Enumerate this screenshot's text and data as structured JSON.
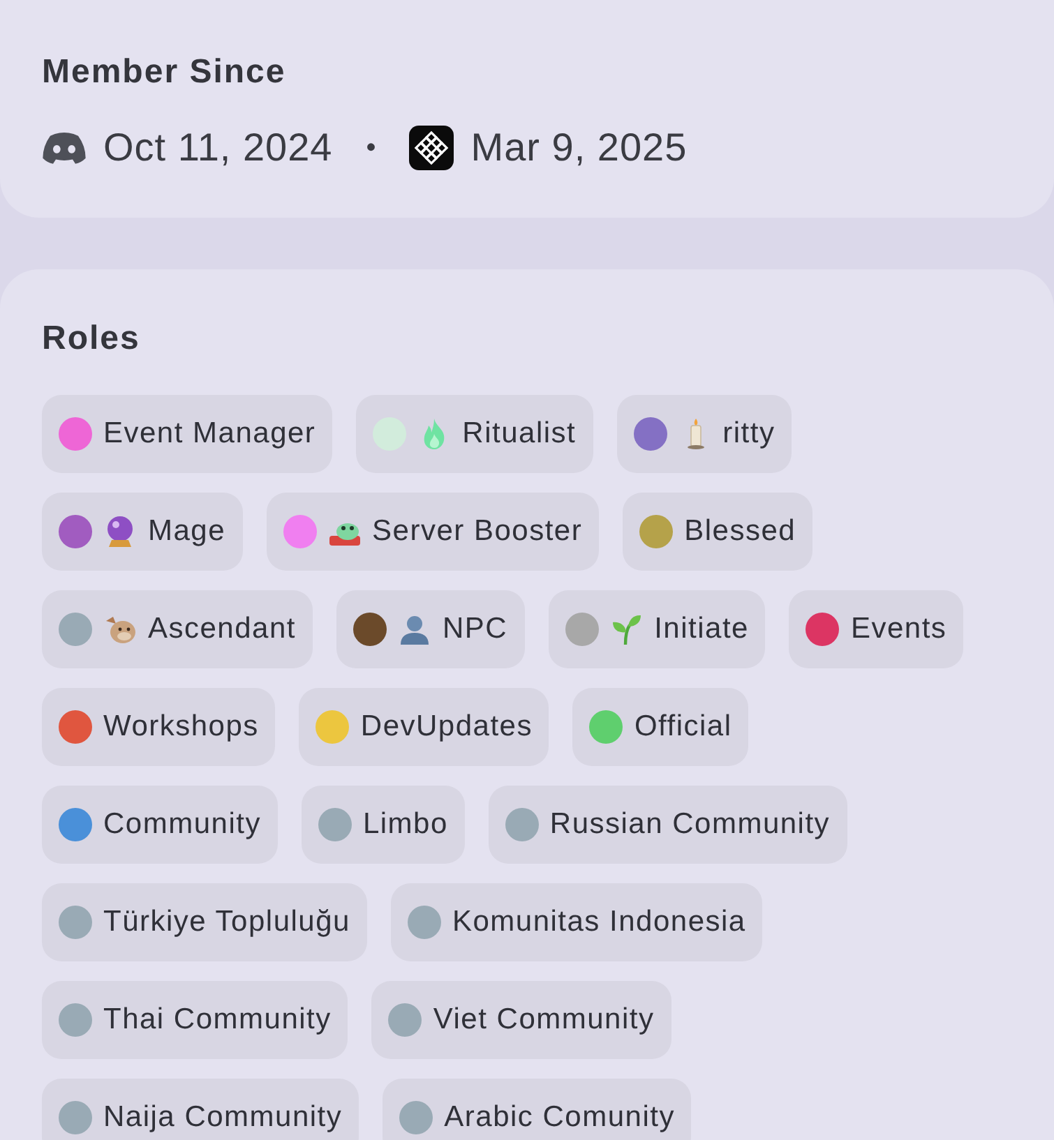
{
  "member_since": {
    "title": "Member Since",
    "dates": [
      {
        "kind": "app",
        "date": "Oct 11, 2024"
      },
      {
        "kind": "server",
        "date": "Mar 9, 2025"
      }
    ],
    "separator": "•"
  },
  "roles": {
    "title": "Roles",
    "items": [
      {
        "name": "Event Manager",
        "color": "#ee66d6",
        "kind": "plain"
      },
      {
        "name": "Ritualist",
        "color": "#d2ecdc",
        "kind": "flame"
      },
      {
        "name": "ritty",
        "color": "#8470c4",
        "kind": "candle"
      },
      {
        "name": "Mage",
        "color": "#a15cc0",
        "kind": "orb"
      },
      {
        "name": "Server Booster",
        "color": "#f07ff0",
        "kind": "frog"
      },
      {
        "name": "Blessed",
        "color": "#b5a24a",
        "kind": "plain"
      },
      {
        "name": "Ascendant",
        "color": "#99aab5",
        "kind": "creature"
      },
      {
        "name": "NPC",
        "color": "#6b4a2a",
        "kind": "bust"
      },
      {
        "name": "Initiate",
        "color": "#a8a8a8",
        "kind": "sprout"
      },
      {
        "name": "Events",
        "color": "#dc3563",
        "kind": "plain"
      },
      {
        "name": "Workshops",
        "color": "#e0563f",
        "kind": "plain"
      },
      {
        "name": "DevUpdates",
        "color": "#ecc63f",
        "kind": "plain"
      },
      {
        "name": "Official",
        "color": "#5fcf6e",
        "kind": "plain"
      },
      {
        "name": "Community",
        "color": "#4a90d9",
        "kind": "plain"
      },
      {
        "name": "Limbo",
        "color": "#99aab5",
        "kind": "plain"
      },
      {
        "name": "Russian Community",
        "color": "#99aab5",
        "kind": "plain"
      },
      {
        "name": "Türkiye Topluluğu",
        "color": "#99aab5",
        "kind": "plain"
      },
      {
        "name": "Komunitas Indonesia",
        "color": "#99aab5",
        "kind": "plain"
      },
      {
        "name": "Thai Community",
        "color": "#99aab5",
        "kind": "plain"
      },
      {
        "name": "Viet Community",
        "color": "#99aab5",
        "kind": "plain"
      },
      {
        "name": "Naija Community",
        "color": "#99aab5",
        "kind": "plain"
      },
      {
        "name": "Arabic Comunity",
        "color": "#99aab5",
        "kind": "plain"
      }
    ]
  }
}
